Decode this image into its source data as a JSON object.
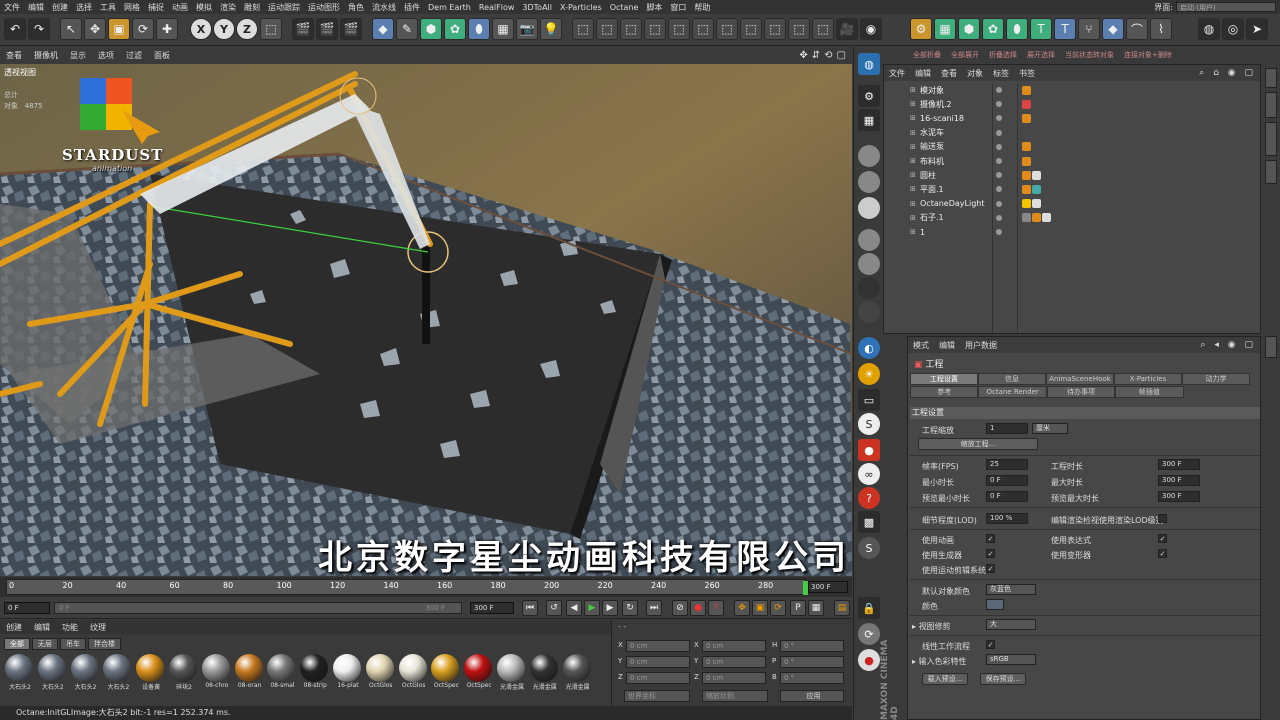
{
  "menubar": {
    "items": [
      "文件",
      "编辑",
      "创建",
      "选择",
      "工具",
      "网格",
      "捕捉",
      "动画",
      "模拟",
      "渲染",
      "雕刻",
      "运动跟踪",
      "运动图形",
      "角色",
      "流水线",
      "插件",
      "Dem Earth",
      "RealFlow",
      "3DToAll",
      "X-Particles",
      "Octane",
      "脚本",
      "窗口",
      "帮助"
    ],
    "layout_label": "界面:",
    "layout_value": "启动 (用户)"
  },
  "viewport": {
    "menu": [
      "查看",
      "摄像机",
      "显示",
      "选项",
      "过滤",
      "面板"
    ],
    "label": "透视视图",
    "stats_label": "总计",
    "objects_label": "对象",
    "objects_value": "4875",
    "logo_text": "STARDUST",
    "logo_sub": "animation",
    "watermark": "北京数字星尘动画科技有限公司"
  },
  "object_manager": {
    "top_actions": [
      "全部折叠",
      "全部展开",
      "折叠选择",
      "展开选择",
      "当前状态转对象",
      "连接对象+删除"
    ],
    "menu": [
      "文件",
      "编辑",
      "查看",
      "对象",
      "标签",
      "书签"
    ],
    "objects": [
      {
        "name": "模对象",
        "tags": [
          "#e08b1c"
        ]
      },
      {
        "name": "摄像机.2",
        "tags": [
          "#d44"
        ]
      },
      {
        "name": "16-scani18",
        "tags": [
          "#e08b1c"
        ]
      },
      {
        "name": "水泥车",
        "tags": []
      },
      {
        "name": "输送泵",
        "tags": [
          "#e08b1c"
        ]
      },
      {
        "name": "布料机",
        "tags": [
          "#e08b1c"
        ]
      },
      {
        "name": "圆柱",
        "tags": [
          "#e08b1c",
          "#ddd"
        ]
      },
      {
        "name": "平面.1",
        "tags": [
          "#e08b1c",
          "#4aa"
        ]
      },
      {
        "name": "OctaneDayLight",
        "tags": [
          "#f2c400",
          "#ddd"
        ]
      },
      {
        "name": "石子.1",
        "tags": [
          "#888",
          "#e08b1c",
          "#ddd"
        ]
      },
      {
        "name": "1",
        "tags": []
      }
    ]
  },
  "attributes": {
    "menu": [
      "模式",
      "编辑",
      "用户数据"
    ],
    "title": "工程",
    "tabs_row1": [
      "工程设置",
      "信息",
      "AnimaSceneHook",
      "X-Particles",
      "动力学"
    ],
    "tabs_row2": [
      "参考",
      "Octane Render",
      "待办事项",
      "帧插值"
    ],
    "section": "工程设置",
    "scale_label": "工程缩放",
    "scale_value": "1",
    "scale_unit": "厘米",
    "scale_btn": "缩放工程...",
    "fps_label": "帧率(FPS)",
    "fps_value": "25",
    "duration_label": "工程时长",
    "duration_value": "300 F",
    "min_label": "最小时长",
    "min_value": "0 F",
    "max_label": "最大时长",
    "max_value": "300 F",
    "pmin_label": "预览最小时长",
    "pmin_value": "0 F",
    "pmax_label": "预览最大时长",
    "pmax_value": "300 F",
    "lod_label": "细节程度(LOD)",
    "lod_value": "100 %",
    "lod_render_label": "编辑渲染检视使用渲染LOD级别",
    "use_anim_label": "使用动画",
    "use_expr_label": "使用表达式",
    "use_gen_label": "使用生成器",
    "use_deform_label": "使用变形器",
    "use_motion_label": "使用运动剪辑系统",
    "default_color_label": "默认对象颜色",
    "default_color_value": "灰蓝色",
    "color_label": "颜色",
    "view_clip_label": "视图修剪",
    "view_clip_value": "大",
    "linear_label": "线性工作流程",
    "input_color_label": "输入色彩特性",
    "input_color_value": "sRGB",
    "load_preset": "载入预设...",
    "save_preset": "保存预设..."
  },
  "timeline": {
    "ticks": [
      "0",
      "20",
      "40",
      "60",
      "80",
      "100",
      "120",
      "140",
      "160",
      "180",
      "200",
      "220",
      "240",
      "260",
      "280"
    ],
    "end_value": "300 F",
    "start_field": "0 F",
    "slider_left": "0 F",
    "slider_right": "300 F",
    "end_field": "300 F"
  },
  "materials": {
    "menu": [
      "创建",
      "编辑",
      "功能",
      "纹理"
    ],
    "tabs": [
      "全部",
      "无层",
      "吊车",
      "拌合楼"
    ],
    "swatches": [
      {
        "name": "大石头2",
        "color": "#6a7480"
      },
      {
        "name": "大石头2",
        "color": "#6a7480"
      },
      {
        "name": "大石头2",
        "color": "#6a7480"
      },
      {
        "name": "大石头2",
        "color": "#6a7480"
      },
      {
        "name": "设备黄",
        "color": "#d9901a"
      },
      {
        "name": "碎块2",
        "color": "#555"
      },
      {
        "name": "08-chro",
        "color": "#999"
      },
      {
        "name": "08-oran",
        "color": "#c77a20"
      },
      {
        "name": "08-smal",
        "color": "#777"
      },
      {
        "name": "08-strip",
        "color": "#222"
      },
      {
        "name": "16-plat",
        "color": "#eee"
      },
      {
        "name": "OctGlos",
        "color": "#e0d4b0"
      },
      {
        "name": "OctGlos",
        "color": "#e8e4d8"
      },
      {
        "name": "OctSpec",
        "color": "#d9a020"
      },
      {
        "name": "OctSpec",
        "color": "#c01010"
      },
      {
        "name": "光滑金属",
        "color": "#bbb"
      },
      {
        "name": "光滑金属",
        "color": "#333"
      },
      {
        "name": "光滑金属",
        "color": "#555"
      }
    ]
  },
  "coords": {
    "rows": [
      {
        "a": "X",
        "av": "0 cm",
        "b": "X",
        "bv": "0 cm",
        "c": "H",
        "cv": "0 °"
      },
      {
        "a": "Y",
        "av": "0 cm",
        "b": "Y",
        "bv": "0 cm",
        "c": "P",
        "cv": "0 °"
      },
      {
        "a": "Z",
        "av": "0 cm",
        "b": "Z",
        "bv": "0 cm",
        "c": "B",
        "cv": "0 °"
      }
    ],
    "world": "世界坐标",
    "scale": "缩放比例",
    "apply": "应用"
  },
  "status": "Octane:InitGLImage:大石头2  bit:-1 res=1  252.374 ms.",
  "brand": "MAXON CINEMA 4D"
}
